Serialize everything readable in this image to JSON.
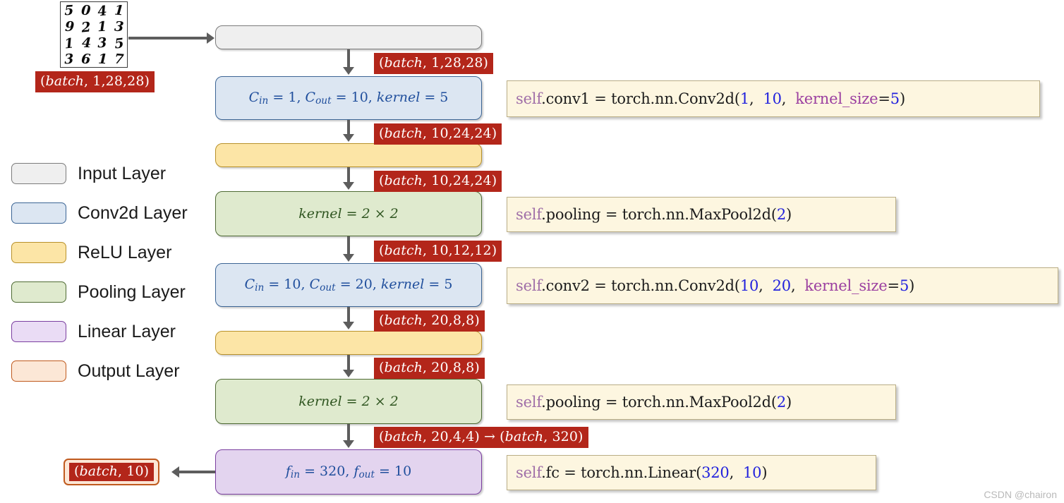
{
  "sample_image": {
    "name": "mnist-digit-grid",
    "digits": [
      "5",
      "0",
      "4",
      "1",
      "9",
      "2",
      "1",
      "3",
      "1",
      "4",
      "3",
      "5",
      "3",
      "6",
      "1",
      "7"
    ],
    "caption": "(batch, 1,28,28)"
  },
  "legend": {
    "items": [
      {
        "label": "Input Layer",
        "color": "#efefef",
        "border": "#7b7b7b"
      },
      {
        "label": "Conv2d Layer",
        "color": "#dce6f2",
        "border": "#3c6595"
      },
      {
        "label": "ReLU Layer",
        "color": "#fce5a6",
        "border": "#b8912a"
      },
      {
        "label": "Pooling Layer",
        "color": "#dfeace",
        "border": "#4f6b34"
      },
      {
        "label": "Linear Layer",
        "color": "#eadcf5",
        "border": "#7b3fa0"
      },
      {
        "label": "Output Layer",
        "color": "#fce7d6",
        "border": "#c05a1e"
      }
    ]
  },
  "nodes": {
    "input": {
      "label": ""
    },
    "conv1": {
      "label": "C_in = 1, C_out = 10, kernel = 5"
    },
    "relu1": {
      "label": ""
    },
    "pool1": {
      "label": "kernel = 2 × 2"
    },
    "conv2": {
      "label": "C_in = 10, C_out = 20, kernel = 5"
    },
    "relu2": {
      "label": ""
    },
    "pool2": {
      "label": "kernel = 2 × 2"
    },
    "linear": {
      "label": "f_in = 320, f_out = 10"
    }
  },
  "shapes": {
    "after_input": "(batch, 1,28,28)",
    "after_conv1": "(batch, 10,24,24)",
    "after_relu1": "(batch, 10,24,24)",
    "after_pool1": "(batch, 10,12,12)",
    "after_conv2": "(batch, 20,8,8)",
    "after_relu2": "(batch, 20,8,8)",
    "after_pool2": "(batch, 20,4,4) → (batch, 320)",
    "output": "(batch, 10)"
  },
  "code": {
    "conv1": "self.conv1 = torch.nn.Conv2d(1,  10,  kernel_size=5)",
    "pool1": "self.pooling = torch.nn.MaxPool2d(2)",
    "conv2": "self.conv2 = torch.nn.Conv2d(10,  20,  kernel_size=5)",
    "pool2": "self.pooling = torch.nn.MaxPool2d(2)",
    "fc": "self.fc = torch.nn.Linear(320,  10)"
  },
  "watermark": "CSDN @chairon",
  "colors": {
    "shape_badge_bg": "#b3261a",
    "code_bg": "#fdf6e0",
    "arrow": "#5d5d5d",
    "conv_text": "#1f4e9c",
    "pool_text": "#2f5520"
  }
}
